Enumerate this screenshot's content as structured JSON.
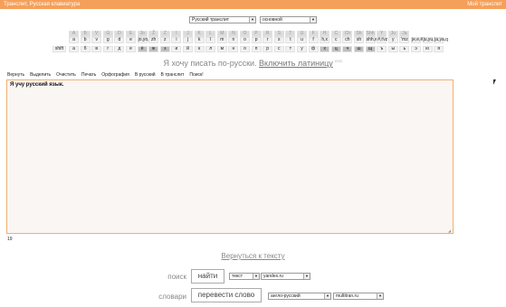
{
  "topbar": {
    "title": "Транслит, Русская клавиатура",
    "mine": "Мой транслит"
  },
  "selects": {
    "mode": "Русский транслит",
    "layout": "основной"
  },
  "keyboard": {
    "upper": [
      "A",
      "Б",
      "V",
      "G",
      "D",
      "E",
      "Jo",
      "Ž",
      "Z",
      "I",
      "J",
      "K",
      "L",
      "M",
      "N",
      "O",
      "P",
      "R",
      "S",
      "T",
      "U",
      "F",
      "H",
      "C",
      "Ch",
      "Sh",
      "Shh",
      "Y",
      "Ju",
      "Ja"
    ],
    "lower": [
      "a",
      "b",
      "v",
      "g",
      "d",
      "e",
      "jo,yo,o",
      "zh",
      "z",
      "i",
      "j",
      "k",
      "l",
      "m",
      "n",
      "o",
      "p",
      "r",
      "s",
      "t",
      "u",
      "f",
      "h,x",
      "c",
      "ch",
      "sh",
      "shh,w",
      "#,ťvz",
      "y",
      "'mz",
      "je,e,ẽ",
      "ju,yu,u",
      "ja,ya,q"
    ],
    "shift": "shift",
    "row3": [
      "а",
      "б",
      "в",
      "г",
      "д",
      "е",
      "ё",
      "ж",
      "з",
      "и",
      "й",
      "к",
      "л",
      "м",
      "н",
      "о",
      "п",
      "р",
      "с",
      "т",
      "у",
      "ф",
      "х",
      "ц",
      "ч",
      "ш",
      "щ",
      "ъ",
      "ы",
      "ь",
      "э",
      "ю",
      "я"
    ]
  },
  "heading": {
    "text": "Я хочу писать по-русски.",
    "link": "Включить латиницу",
    "sup": "ESC"
  },
  "toolbar": [
    "Вернуть",
    "Выделить",
    "Очистить",
    "Печать",
    "Орфография",
    "В русский",
    "В транслит",
    "Поиск!"
  ],
  "editor": {
    "text": "Я учу русский язык."
  },
  "counter": "19",
  "back": "Вернуться к тексту",
  "search": {
    "label": "поиск",
    "button": "найти",
    "type": "текст",
    "engine": "yandex.ru"
  },
  "dict": {
    "label": "словари",
    "button": "перевести слово",
    "pair": "англо-русский",
    "site": "multitran.ru"
  }
}
